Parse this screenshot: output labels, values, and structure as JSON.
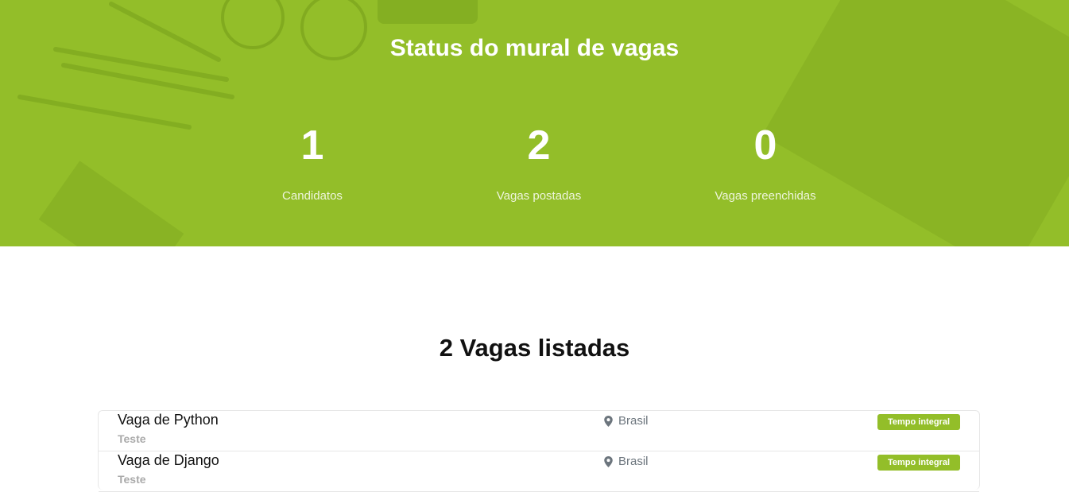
{
  "hero": {
    "title": "Status do mural de vagas",
    "accent_color": "#93be29",
    "stats": [
      {
        "value": "1",
        "label": "Candidatos"
      },
      {
        "value": "2",
        "label": "Vagas postadas"
      },
      {
        "value": "0",
        "label": "Vagas preenchidas"
      }
    ]
  },
  "listing": {
    "title": "2 Vagas listadas",
    "jobs": [
      {
        "title": "Vaga de Python",
        "company": "Teste",
        "location": "Brasil",
        "type": "Tempo integral"
      },
      {
        "title": "Vaga de Django",
        "company": "Teste",
        "location": "Brasil",
        "type": "Tempo integral"
      }
    ]
  }
}
